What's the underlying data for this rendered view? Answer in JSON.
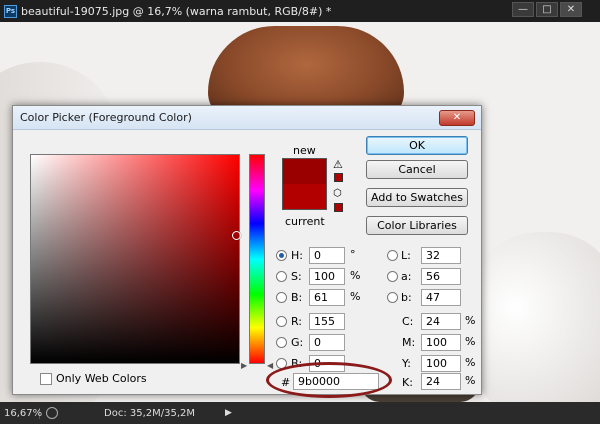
{
  "window": {
    "title": "beautiful-19075.jpg @ 16,7% (warna rambut, RGB/8#) *",
    "app_icon": "Ps",
    "min_glyph": "—",
    "max_glyph": "□",
    "close_glyph": "✕"
  },
  "dialog": {
    "title": "Color Picker (Foreground Color)",
    "close_glyph": "✕",
    "new_label": "new",
    "current_label": "current",
    "new_color": "#9b0000",
    "current_color": "#b20000",
    "warning_icon": "⚠",
    "cube_icon": "⬡",
    "buttons": {
      "ok": "OK",
      "cancel": "Cancel",
      "add_to_swatches": "Add to Swatches",
      "color_libraries": "Color Libraries"
    },
    "only_web_colors": "Only Web Colors",
    "only_web_colors_checked": false,
    "hsb": {
      "h": {
        "label": "H:",
        "value": "0",
        "unit": "°",
        "selected": true
      },
      "s": {
        "label": "S:",
        "value": "100",
        "unit": "%",
        "selected": false
      },
      "b": {
        "label": "B:",
        "value": "61",
        "unit": "%",
        "selected": false
      }
    },
    "rgb": {
      "r": {
        "label": "R:",
        "value": "155"
      },
      "g": {
        "label": "G:",
        "value": "0"
      },
      "b": {
        "label": "B:",
        "value": "0"
      }
    },
    "lab": {
      "l": {
        "label": "L:",
        "value": "32"
      },
      "a": {
        "label": "a:",
        "value": "56"
      },
      "b": {
        "label": "b:",
        "value": "47"
      }
    },
    "cmyk": {
      "c": {
        "label": "C:",
        "value": "24",
        "unit": "%"
      },
      "m": {
        "label": "M:",
        "value": "100",
        "unit": "%"
      },
      "y": {
        "label": "Y:",
        "value": "100",
        "unit": "%"
      },
      "k": {
        "label": "K:",
        "value": "24",
        "unit": "%"
      }
    },
    "hex": {
      "label": "#",
      "value": "9b0000"
    },
    "hue_arrow": "▶"
  },
  "status": {
    "zoom": "16,67%",
    "doc": "Doc: 35,2M/35,2M",
    "arrow": "▶"
  },
  "colors": {
    "highlight_oval": "#8b1a1a"
  }
}
